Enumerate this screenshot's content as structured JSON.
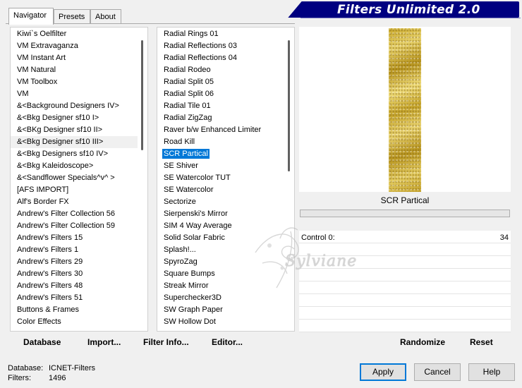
{
  "tabs": [
    {
      "label": "Navigator",
      "active": true
    },
    {
      "label": "Presets",
      "active": false
    },
    {
      "label": "About",
      "active": false
    }
  ],
  "banner": {
    "title": "Filters Unlimited 2.0"
  },
  "categories": [
    {
      "label": "Kiwi`s Oelfilter"
    },
    {
      "label": "VM Extravaganza"
    },
    {
      "label": "VM Instant Art"
    },
    {
      "label": "VM Natural"
    },
    {
      "label": "VM Toolbox"
    },
    {
      "label": "VM"
    },
    {
      "label": "&<Background Designers IV>"
    },
    {
      "label": "&<Bkg Designer sf10 I>"
    },
    {
      "label": "&<BKg Designer sf10 II>"
    },
    {
      "label": "&<Bkg Designer sf10 III>"
    },
    {
      "label": "&<Bkg Designers sf10 IV>"
    },
    {
      "label": "&<Bkg Kaleidoscope>"
    },
    {
      "label": "&<Sandflower Specials^v^ >"
    },
    {
      "label": "[AFS IMPORT]"
    },
    {
      "label": "Alf's Border FX"
    },
    {
      "label": "Andrew's Filter Collection 56"
    },
    {
      "label": "Andrew's Filter Collection 59"
    },
    {
      "label": "Andrew's Filters 15"
    },
    {
      "label": "Andrew's Filters 1"
    },
    {
      "label": "Andrew's Filters 29"
    },
    {
      "label": "Andrew's Filters 30"
    },
    {
      "label": "Andrew's Filters 48"
    },
    {
      "label": "Andrew's Filters 51"
    },
    {
      "label": "Buttons & Frames"
    },
    {
      "label": "Color Effects"
    }
  ],
  "categories_selected_index": 9,
  "filters": [
    {
      "label": "Radial  Rings 01"
    },
    {
      "label": "Radial Reflections 03"
    },
    {
      "label": "Radial Reflections 04"
    },
    {
      "label": "Radial Rodeo"
    },
    {
      "label": "Radial Split 05"
    },
    {
      "label": "Radial Split 06"
    },
    {
      "label": "Radial Tile 01"
    },
    {
      "label": "Radial ZigZag"
    },
    {
      "label": "Raver b/w Enhanced Limiter"
    },
    {
      "label": "Road Kill"
    },
    {
      "label": "SCR  Partical"
    },
    {
      "label": "SE Shiver"
    },
    {
      "label": "SE Watercolor TUT"
    },
    {
      "label": "SE Watercolor"
    },
    {
      "label": "Sectorize"
    },
    {
      "label": "Sierpenski's Mirror"
    },
    {
      "label": "SIM 4 Way Average"
    },
    {
      "label": "Solid Solar Fabric"
    },
    {
      "label": "Splash!..."
    },
    {
      "label": "SpyroZag"
    },
    {
      "label": "Square Bumps"
    },
    {
      "label": "Streak Mirror"
    },
    {
      "label": "Superchecker3D"
    },
    {
      "label": "SW Graph Paper"
    },
    {
      "label": "SW Hollow Dot"
    }
  ],
  "filters_selected_index": 10,
  "preview": {
    "filter_name": "SCR  Partical",
    "colors": {
      "gold_light": "#e8d26a",
      "gold_dark": "#b8951e"
    }
  },
  "controls": [
    {
      "label": "Control 0:",
      "value": "34"
    }
  ],
  "watermark": {
    "text": "Sylviane"
  },
  "toolbar": {
    "database": "Database",
    "import": "Import...",
    "filter_info": "Filter Info...",
    "editor": "Editor...",
    "randomize": "Randomize",
    "reset": "Reset"
  },
  "status": {
    "database_label": "Database:",
    "database_value": "ICNET-Filters",
    "filters_label": "Filters:",
    "filters_value": "1496"
  },
  "buttons": {
    "apply": "Apply",
    "cancel": "Cancel",
    "help": "Help"
  },
  "colors": {
    "banner": "#000080",
    "selection": "#0078d7",
    "default_button_border": "#0078d7"
  }
}
